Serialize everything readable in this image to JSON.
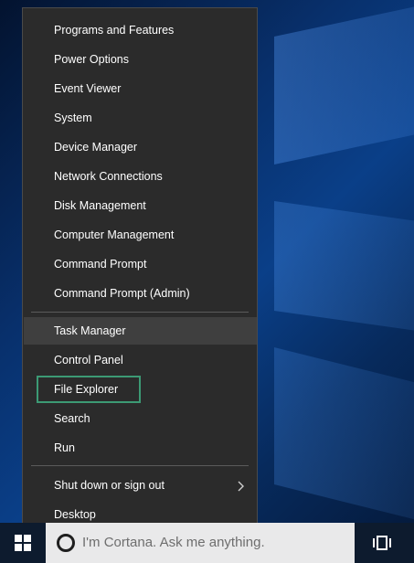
{
  "menu": {
    "groups": [
      {
        "items": [
          {
            "label": "Programs and Features"
          },
          {
            "label": "Power Options"
          },
          {
            "label": "Event Viewer"
          },
          {
            "label": "System"
          },
          {
            "label": "Device Manager"
          },
          {
            "label": "Network Connections"
          },
          {
            "label": "Disk Management"
          },
          {
            "label": "Computer Management"
          },
          {
            "label": "Command Prompt"
          },
          {
            "label": "Command Prompt (Admin)"
          }
        ]
      },
      {
        "items": [
          {
            "label": "Task Manager",
            "state": "hover"
          },
          {
            "label": "Control Panel"
          },
          {
            "label": "File Explorer",
            "state": "focused"
          },
          {
            "label": "Search"
          },
          {
            "label": "Run"
          }
        ]
      },
      {
        "items": [
          {
            "label": "Shut down or sign out",
            "submenu": true
          },
          {
            "label": "Desktop"
          }
        ]
      }
    ]
  },
  "taskbar": {
    "search_placeholder": "I'm Cortana. Ask me anything."
  },
  "icons": {
    "start": "windows-logo-icon",
    "cortana": "cortana-ring-icon",
    "task_view": "task-view-icon",
    "submenu": "chevron-right-icon"
  },
  "colors": {
    "menu_background": "#2b2b2b",
    "hover_background": "#3f3f3f",
    "focus_border": "#3c9a74",
    "search_background": "#e9e9ea",
    "taskbar_background": "#0d1b2e"
  }
}
